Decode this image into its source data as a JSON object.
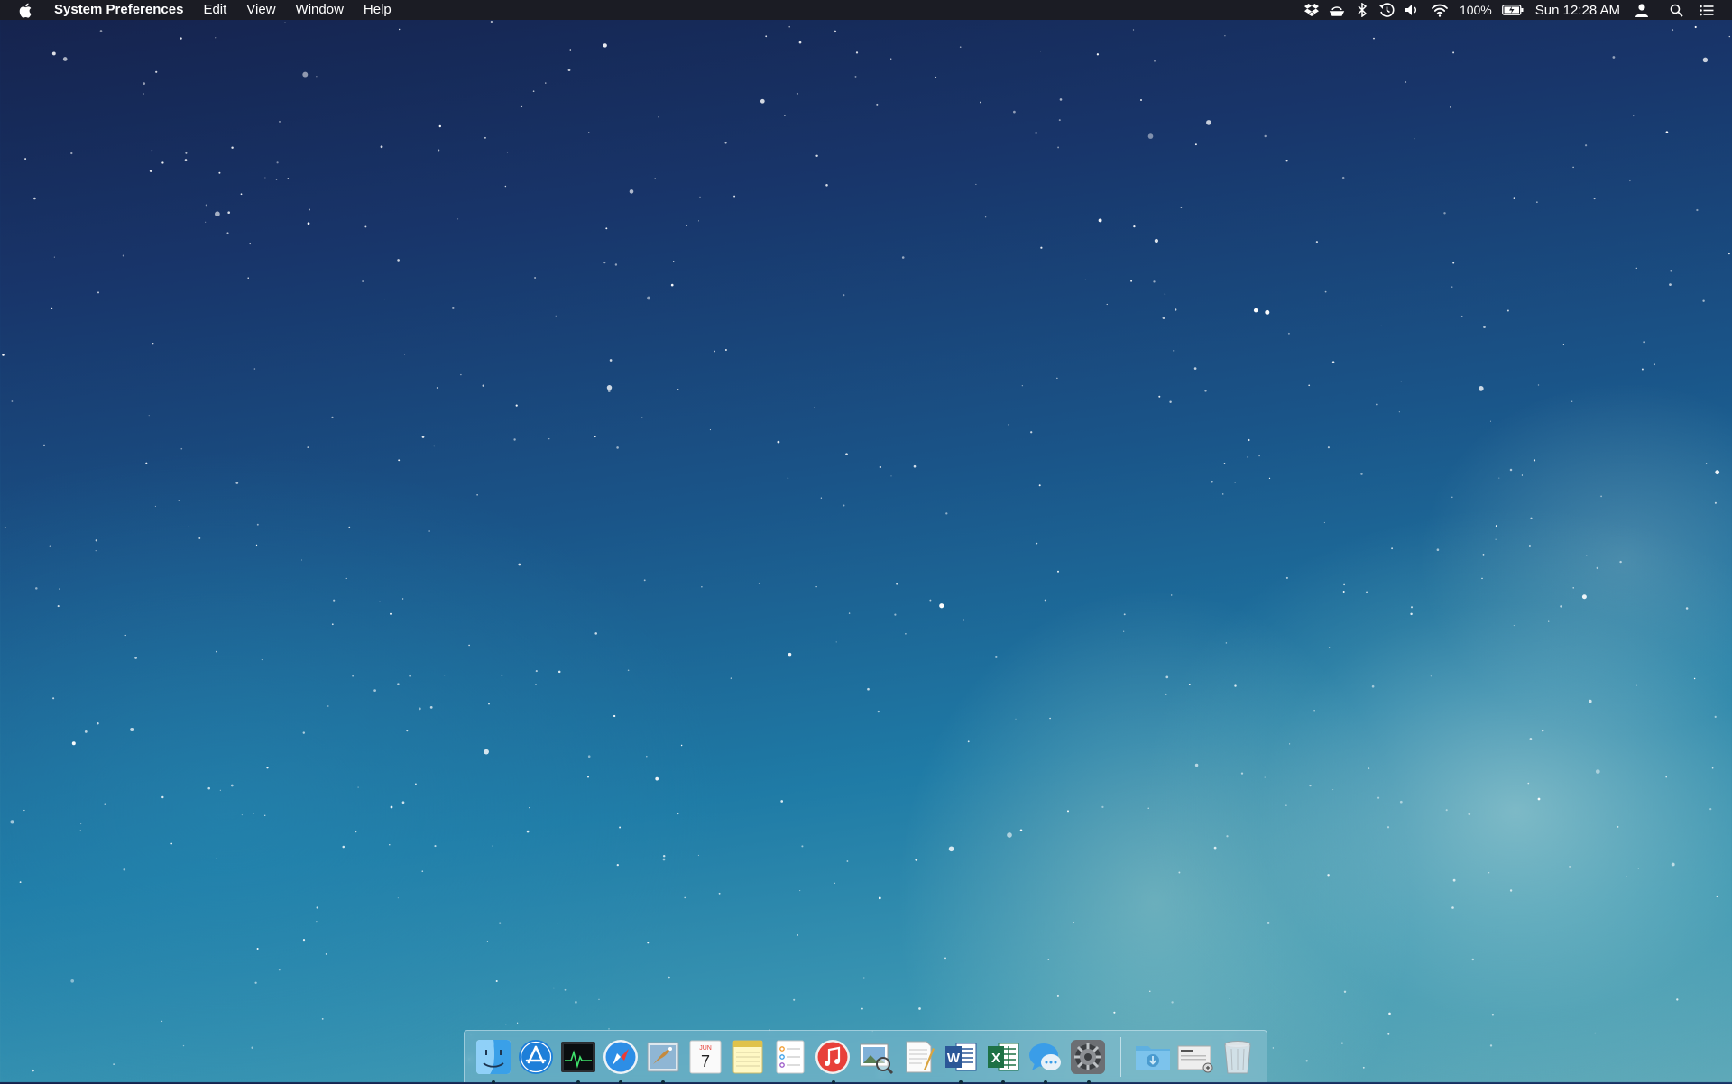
{
  "menubar": {
    "app_name": "System Preferences",
    "menus": [
      "Edit",
      "View",
      "Window",
      "Help"
    ],
    "status": {
      "icons": [
        "dropbox-icon",
        "drive-sync-icon",
        "bluetooth-icon",
        "time-machine-icon",
        "volume-icon",
        "wifi-icon"
      ],
      "battery_percent": "100%",
      "clock": "Sun 12:28 AM"
    }
  },
  "dock": {
    "calendar": {
      "month": "JUN",
      "day": "7"
    },
    "apps": [
      {
        "name": "Finder",
        "icon": "finder-icon",
        "running": true
      },
      {
        "name": "App Store",
        "icon": "app-store-icon",
        "running": false
      },
      {
        "name": "Activity Monitor",
        "icon": "activity-monitor-icon",
        "running": true
      },
      {
        "name": "Safari",
        "icon": "safari-icon",
        "running": true
      },
      {
        "name": "Mail",
        "icon": "mail-icon",
        "running": true
      },
      {
        "name": "Calendar",
        "icon": "calendar-icon",
        "running": false
      },
      {
        "name": "Notes",
        "icon": "notes-icon",
        "running": false
      },
      {
        "name": "Reminders",
        "icon": "reminders-icon",
        "running": false
      },
      {
        "name": "iTunes",
        "icon": "itunes-icon",
        "running": true
      },
      {
        "name": "Preview",
        "icon": "preview-icon",
        "running": false
      },
      {
        "name": "TextEdit",
        "icon": "textedit-icon",
        "running": false
      },
      {
        "name": "Microsoft Word",
        "icon": "word-icon",
        "running": true
      },
      {
        "name": "Microsoft Excel",
        "icon": "excel-icon",
        "running": true
      },
      {
        "name": "Messages",
        "icon": "messages-icon",
        "running": true
      },
      {
        "name": "System Preferences",
        "icon": "system-preferences-icon",
        "running": true
      }
    ],
    "stacks": [
      {
        "name": "Downloads",
        "icon": "downloads-folder-icon"
      },
      {
        "name": "Documents",
        "icon": "documents-stack-icon"
      },
      {
        "name": "Trash",
        "icon": "trash-icon"
      }
    ]
  },
  "colors": {
    "menubar_bg": "#1b1c24",
    "accent_red": "#e8403a",
    "word_blue": "#2b5797",
    "excel_green": "#1e7145"
  }
}
